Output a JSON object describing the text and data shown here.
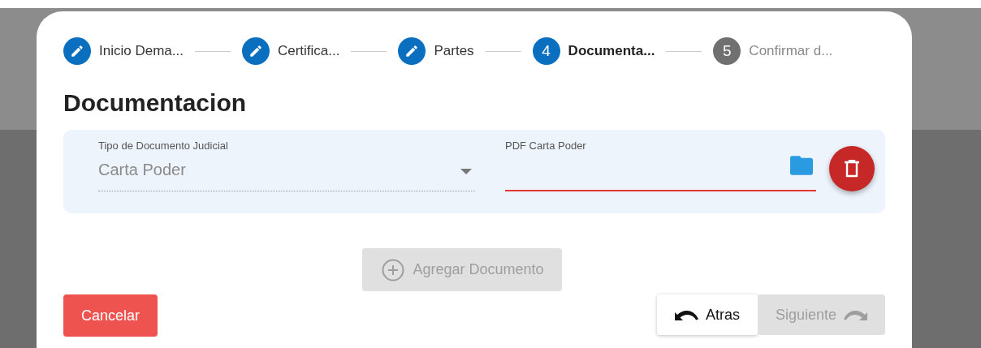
{
  "stepper": [
    {
      "label": "Inicio Dema...",
      "completed": true,
      "selected": false
    },
    {
      "label": "Certifica...",
      "completed": true,
      "selected": false
    },
    {
      "label": "Partes",
      "completed": true,
      "selected": false
    },
    {
      "label": "Documenta...",
      "completed": false,
      "selected": true,
      "number": "4"
    },
    {
      "label": "Confirmar d...",
      "completed": false,
      "selected": false,
      "number": "5"
    }
  ],
  "title": "Documentacion",
  "document": {
    "type_field": {
      "label": "Tipo de Documento Judicial",
      "value": "Carta Poder",
      "disabled": true
    },
    "file_field": {
      "label": "PDF Carta Poder",
      "error": true
    }
  },
  "add_button": {
    "label": "Agregar Documento",
    "disabled": true
  },
  "cancel_button": {
    "label": "Cancelar"
  },
  "back_button": {
    "label": "Atras",
    "disabled": false
  },
  "next_button": {
    "label": "Siguiente",
    "disabled": true
  }
}
